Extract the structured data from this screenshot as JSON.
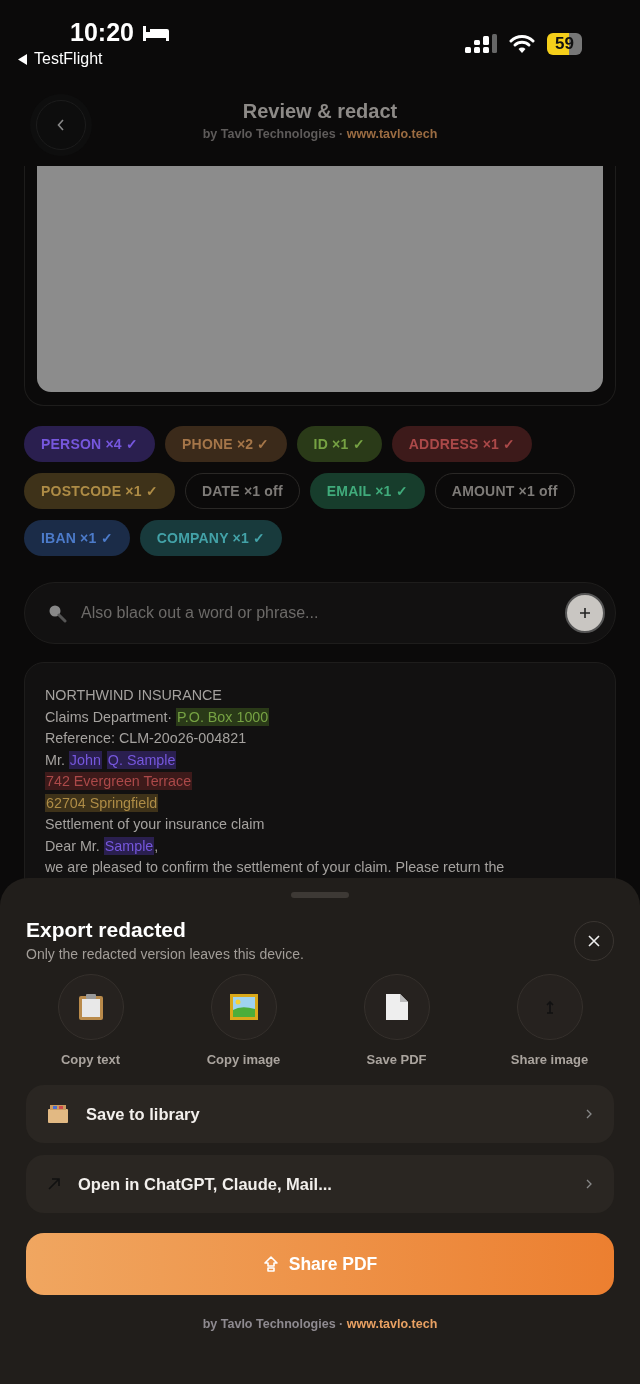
{
  "status_bar": {
    "time": "10:20",
    "back_app": "TestFlight",
    "battery": "59"
  },
  "header": {
    "title": "Review & redact",
    "byline": "by Tavlo Technologies · ",
    "link": "www.tavlo.tech"
  },
  "chips": [
    {
      "label": "PERSON ×4 ✓",
      "on": true,
      "color": "#2a1f4f"
    },
    {
      "label": "PHONE ×2 ✓",
      "on": true,
      "color": "#3b2a1a"
    },
    {
      "label": "ID ×1 ✓",
      "on": true,
      "color": "#2a3a18"
    },
    {
      "label": "ADDRESS ×1 ✓",
      "on": true,
      "color": "#3d1a1a"
    },
    {
      "label": "POSTCODE ×1 ✓",
      "on": true,
      "color": "#3e3219"
    },
    {
      "label": "DATE ×1 off",
      "on": false
    },
    {
      "label": "EMAIL ×1 ✓",
      "on": true,
      "color": "#173d2c"
    },
    {
      "label": "AMOUNT ×1 off",
      "on": false
    },
    {
      "label": "IBAN ×1 ✓",
      "on": true,
      "color": "#1b2c48"
    },
    {
      "label": "COMPANY ×1 ✓",
      "on": true,
      "color": "#183a3c"
    }
  ],
  "search": {
    "placeholder": "Also black out a word or phrase..."
  },
  "document": [
    [
      {
        "text": "NORTHWIND INSURANCE"
      }
    ],
    [
      {
        "text": "Claims Department· "
      },
      {
        "text": "P.O. Box 1000",
        "color": "#2a3a18"
      }
    ],
    [
      {
        "text": "Reference: CLM-20o26-004821"
      }
    ],
    [
      {
        "text": "Mr. "
      },
      {
        "text": "John",
        "color": "#2a1f4f"
      },
      {
        "text": "Q. Sample",
        "color": "#2a1f4f"
      }
    ],
    [
      {
        "text": "742 Evergreen Terrace",
        "color": "#3d1a1a"
      }
    ],
    [
      {
        "text": "62704 Springfield",
        "color": "#3e3219"
      }
    ],
    [
      {
        "text": "Settlement of your insurance claim"
      }
    ],
    [
      {
        "text": "Dear Mr. "
      },
      {
        "text": "Sample",
        "color": "#2a1f4f"
      },
      {
        "text": ","
      }
    ],
    [
      {
        "text": "we are pleased to confirm the settlement of your claim. Please return the"
      }
    ]
  ],
  "sheet": {
    "title": "Export redacted",
    "subtitle": "Only the redacted version leaves this device.",
    "actions": [
      {
        "kind": "clipboard",
        "label": "Copy text"
      },
      {
        "kind": "image",
        "label": "Copy image"
      },
      {
        "kind": "document",
        "label": "Save PDF"
      },
      {
        "kind": "share",
        "label": "Share image"
      }
    ],
    "rows": [
      {
        "kind": "box",
        "label": "Save to library"
      },
      {
        "kind": "arrow",
        "label": "Open in ChatGPT, Claude, Mail..."
      }
    ],
    "primary": "Share PDF",
    "footer": {
      "byline": "by Tavlo Technologies · ",
      "link": "www.tavlo.tech"
    }
  }
}
